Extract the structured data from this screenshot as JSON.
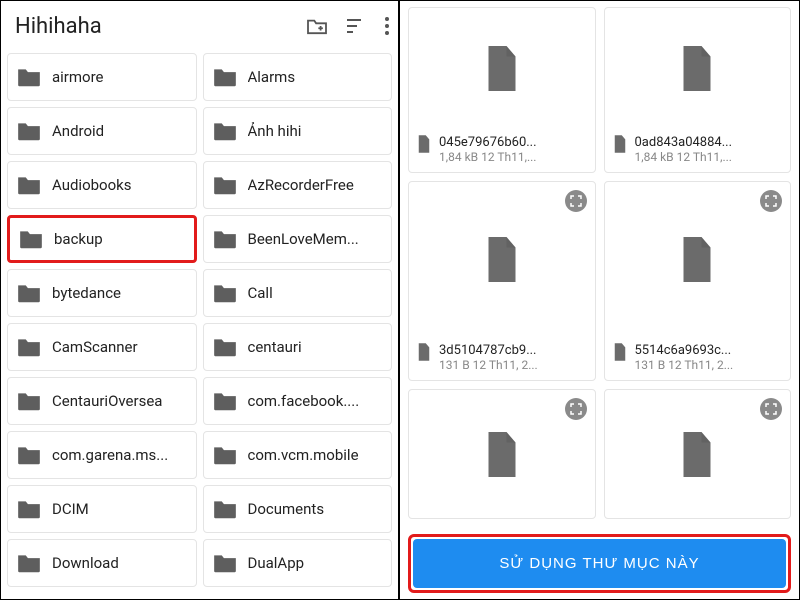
{
  "left": {
    "title": "Hihihaha",
    "folders": [
      {
        "label": "airmore",
        "highlight": false
      },
      {
        "label": "Alarms",
        "highlight": false
      },
      {
        "label": "Android",
        "highlight": false
      },
      {
        "label": "Ảnh hihi",
        "highlight": false
      },
      {
        "label": "Audiobooks",
        "highlight": false
      },
      {
        "label": "AzRecorderFree",
        "highlight": false
      },
      {
        "label": "backup",
        "highlight": true
      },
      {
        "label": "BeenLoveMem...",
        "highlight": false
      },
      {
        "label": "bytedance",
        "highlight": false
      },
      {
        "label": "Call",
        "highlight": false
      },
      {
        "label": "CamScanner",
        "highlight": false
      },
      {
        "label": "centauri",
        "highlight": false
      },
      {
        "label": "CentauriOversea",
        "highlight": false
      },
      {
        "label": "com.facebook....",
        "highlight": false
      },
      {
        "label": "com.garena.ms...",
        "highlight": false
      },
      {
        "label": "com.vcm.mobile",
        "highlight": false
      },
      {
        "label": "DCIM",
        "highlight": false
      },
      {
        "label": "Documents",
        "highlight": false
      },
      {
        "label": "Download",
        "highlight": false
      },
      {
        "label": "DualApp",
        "highlight": false
      }
    ]
  },
  "right": {
    "files": [
      {
        "name": "045e79676b60...",
        "meta": "1,84 kB 12 Th11,...",
        "expand": false,
        "cls": "tall"
      },
      {
        "name": "0ad843a04884...",
        "meta": "1,84 kB 12 Th11,...",
        "expand": false,
        "cls": "tall"
      },
      {
        "name": "3d5104787cb9...",
        "meta": "131 B 12 Th11, 2...",
        "expand": true,
        "cls": "short"
      },
      {
        "name": "5514c6a9693c...",
        "meta": "131 B 12 Th11, 2...",
        "expand": true,
        "cls": "short"
      },
      {
        "name": "",
        "meta": "",
        "expand": true,
        "cls": "cut"
      },
      {
        "name": "",
        "meta": "",
        "expand": true,
        "cls": "cut"
      }
    ],
    "button": "SỬ DỤNG THƯ MỤC NÀY"
  }
}
